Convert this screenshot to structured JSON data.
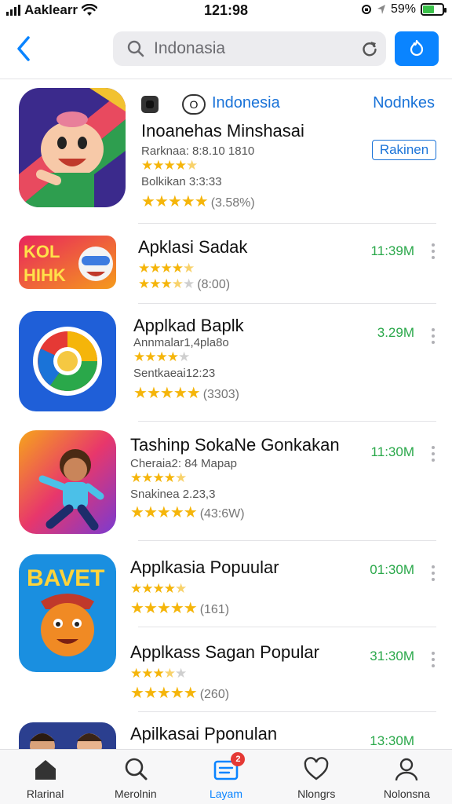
{
  "status_bar": {
    "carrier": "Aaklearr",
    "time": "121:98",
    "battery": "59%",
    "battery_level": 0.59,
    "icons": [
      "signal-icon",
      "wifi-icon",
      "rotation-lock-icon",
      "location-icon",
      "battery-icon"
    ]
  },
  "search": {
    "value": "Indonasia"
  },
  "featured": {
    "category": "Indonesia",
    "link": "Nodnkes",
    "title": "Inoanehas Minshasai",
    "line1": "Rarknaa: 8:8.10 1810",
    "line2": "Bolkikan 3:3:33",
    "rating1": 4.5,
    "rating2": 5,
    "rating2_count": "(3.58%)",
    "button": "Rakinen"
  },
  "apps": [
    {
      "title": "Apklasi Sadak",
      "rating1": 4.5,
      "rating2": 3.5,
      "rating2_count": "(8:00)",
      "size": "11:39M"
    },
    {
      "title": "Applkad Baplk",
      "line1": "Annmalar1,4pla8o",
      "rating1": 4,
      "line2": "Sentkaeai12:23",
      "rating2": 5,
      "rating2_count": "(3303)",
      "size": "3.29M"
    },
    {
      "title": "Tashinp SokaNe Gonkakan",
      "line1": "Cheraia2: 84 Mapap",
      "rating1": 4.5,
      "line2": "Snakinea 2.23,3",
      "rating2": 5,
      "rating2_count": "(43:6W)",
      "size": "11:30M"
    },
    {
      "title": "Applkasia Popuular",
      "rating1": 4.5,
      "rating2": 5,
      "rating2_count": "(161)",
      "size": "01:30M"
    },
    {
      "title": "Applkass Sagan Popular",
      "rating1": 3.5,
      "rating2": 5,
      "rating2_count": "(260)",
      "size": "31:30M"
    },
    {
      "title": "Apilkasai Pponulan",
      "size": "13:30M"
    }
  ],
  "app_icons": {
    "kolhihk_text": "KOL HIHK",
    "bavet_text": "BAVET"
  },
  "tabs": [
    {
      "label": "Rlarinal",
      "icon": "home-icon"
    },
    {
      "label": "Merolnin",
      "icon": "search-icon"
    },
    {
      "label": "Layam",
      "icon": "updates-icon",
      "badge": "2"
    },
    {
      "label": "Nlongrs",
      "icon": "heart-icon"
    },
    {
      "label": "Nolonsna",
      "icon": "profile-icon"
    }
  ],
  "colors": {
    "accent": "#0a84ff",
    "link": "#1a73d8",
    "size_green": "#2aa84a",
    "star": "#f5b50a",
    "badge_red": "#e53935"
  }
}
